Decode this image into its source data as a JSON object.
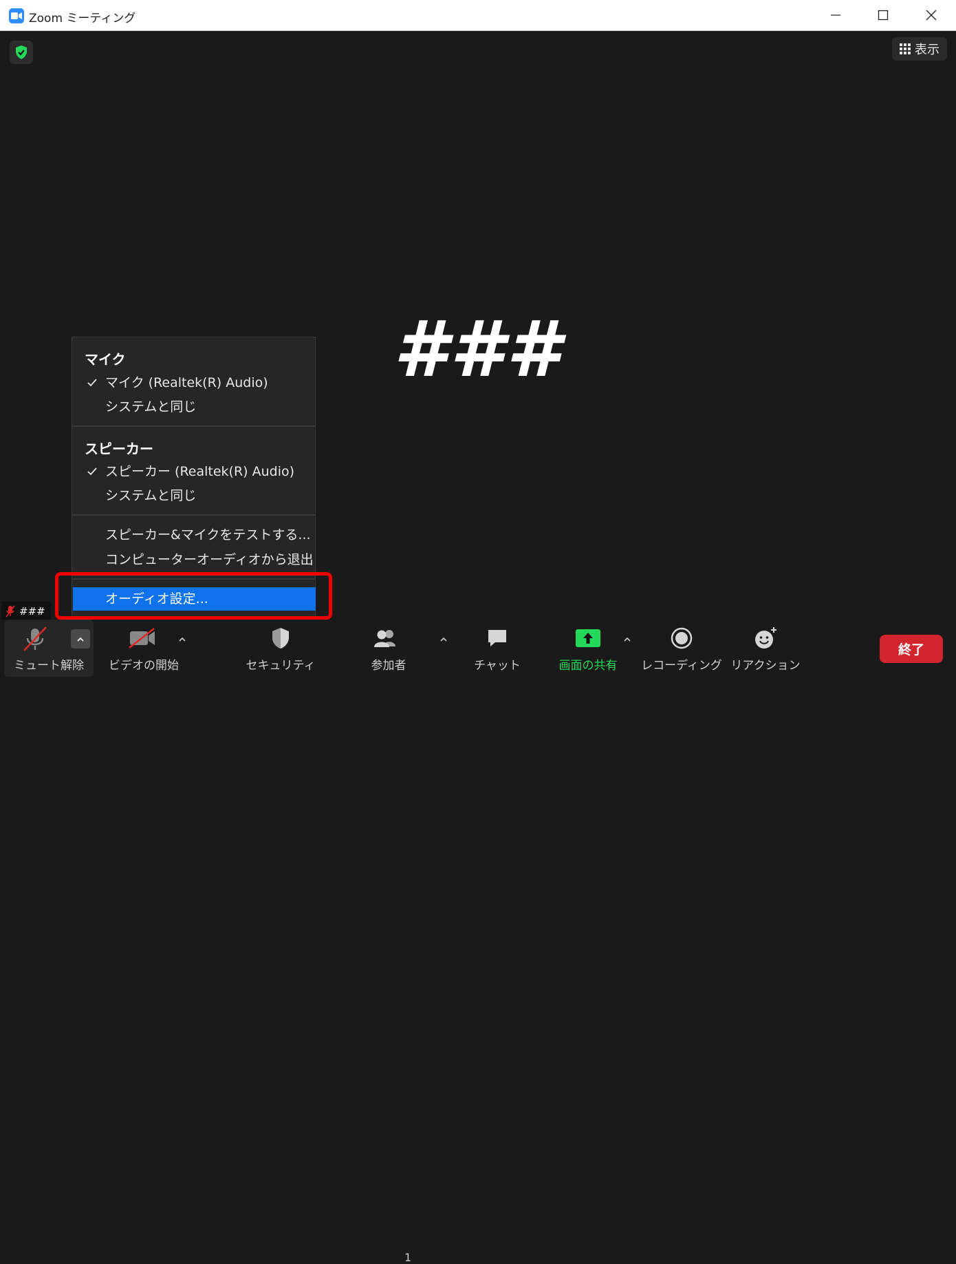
{
  "window": {
    "title": "Zoom ミーティング"
  },
  "stage": {
    "view_label": "表示",
    "participant_name": "###"
  },
  "audio_menu": {
    "mic_header": "マイク",
    "mic_items": [
      "マイク (Realtek(R) Audio)",
      "システムと同じ"
    ],
    "speaker_header": "スピーカー",
    "speaker_items": [
      "スピーカー (Realtek(R) Audio)",
      "システムと同じ"
    ],
    "actions": [
      "スピーカー&マイクをテストする...",
      "コンピューターオーディオから退出"
    ],
    "settings_label": "オーディオ設定..."
  },
  "self_badge": {
    "name": "###"
  },
  "toolbar": {
    "unmute": "ミュート解除",
    "start_video": "ビデオの開始",
    "security": "セキュリティ",
    "participants": "参加者",
    "participants_count": "1",
    "chat": "チャット",
    "share_screen": "画面の共有",
    "recording": "レコーディング",
    "reactions": "リアクション",
    "end": "終了"
  },
  "colors": {
    "accent_blue": "#0e72ed",
    "share_green": "#23d959",
    "end_red": "#d2242c",
    "highlight_red": "#ee0000",
    "mute_red": "#e02828"
  }
}
